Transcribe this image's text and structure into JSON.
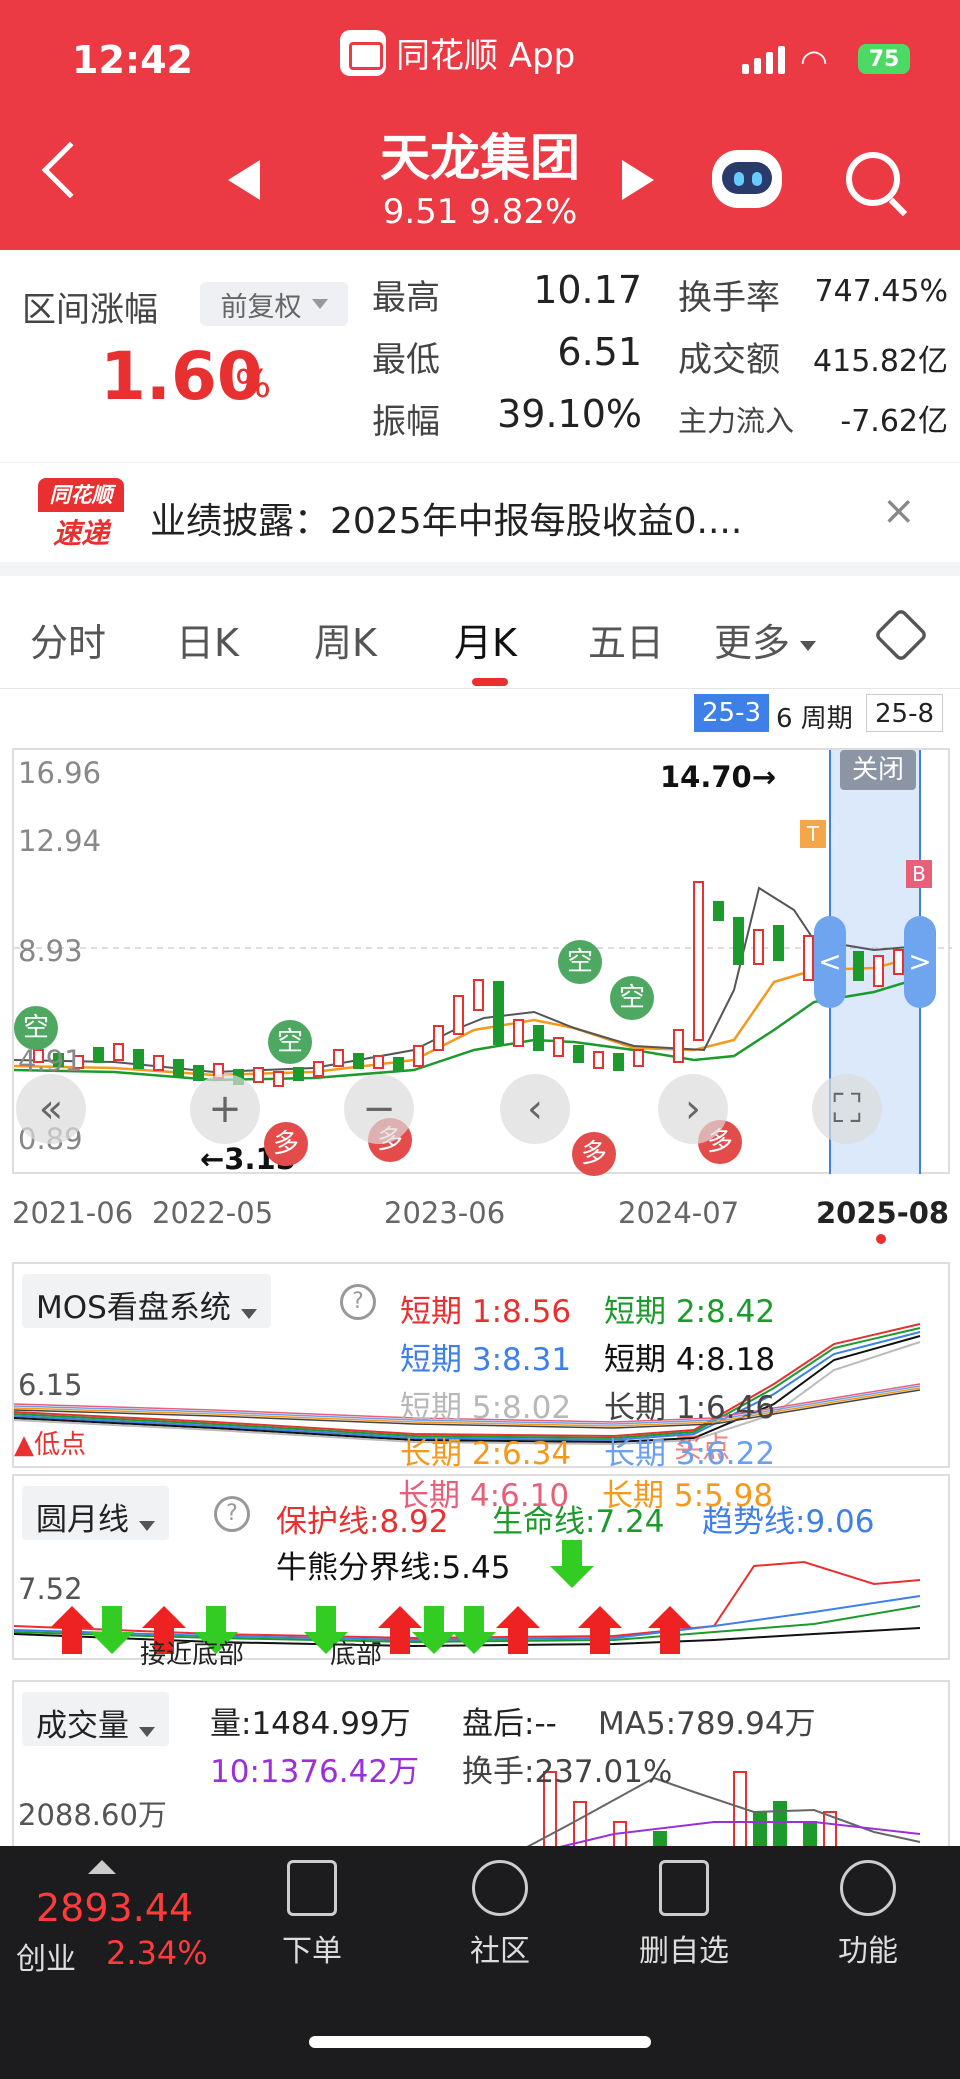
{
  "status": {
    "time": "12:42",
    "battery": "75"
  },
  "app": {
    "title": "同花顺 App"
  },
  "stock": {
    "name": "天龙集团",
    "price_line": "9.51  9.82%"
  },
  "stats": {
    "range_label": "区间涨幅",
    "adjust_label": "前复权",
    "range_value": "1.60",
    "range_unit": "%",
    "high_label": "最高",
    "high_value": "10.17",
    "low_label": "最低",
    "low_value": "6.51",
    "amp_label": "振幅",
    "amp_value": "39.10%",
    "turnover_label": "换手率",
    "turnover_value": "747.45%",
    "volume_label": "成交额",
    "volume_value": "415.82亿",
    "flow_label": "主力流入",
    "flow_value": "-7.62亿"
  },
  "banner": {
    "badge_top": "同花顺",
    "badge_bottom": "速递",
    "text": "业绩披露：2025年中报每股收益0....",
    "close": "×"
  },
  "tabs": [
    "分时",
    "日K",
    "周K",
    "月K",
    "五日",
    "更多"
  ],
  "range_bar": {
    "start": "25-3",
    "period": "6 周期",
    "end": "25-8"
  },
  "kline": {
    "y_ticks": [
      "16.96",
      "12.94",
      "8.93",
      "4.91",
      "0.89"
    ],
    "x_ticks": [
      "2021-06",
      "2022-05",
      "2023-06",
      "2024-07",
      "2025-08"
    ],
    "max_label": "14.70→",
    "min_label": "←3.15",
    "close_button": "关闭",
    "signals": {
      "kong": "空",
      "duo": "多",
      "t": "T",
      "b": "B"
    }
  },
  "mos": {
    "name": "MOS看盘系统",
    "y_tick": "6.15",
    "low_point": "▲低点",
    "legend": [
      {
        "text": "短期 1:8.56",
        "color": "#e93030"
      },
      {
        "text": "短期 2:8.42",
        "color": "#1c9a2c"
      },
      {
        "text": "短期 3:8.31",
        "color": "#3f7fe8"
      },
      {
        "text": "短期 4:8.18",
        "color": "#111111"
      },
      {
        "text": "短期 5:8.02",
        "color": "#b8b8b8"
      },
      {
        "text": "长期 1:6.46",
        "color": "#444444"
      },
      {
        "text": "长期 2:6.34",
        "color": "#f39a1e"
      },
      {
        "text": "长期 3:6.22",
        "color": "#6aa0f0"
      },
      {
        "text": "长期 4:6.10",
        "color": "#e85f7a"
      },
      {
        "text": "长期 5:5.98",
        "color": "#f39a1e"
      }
    ],
    "overlay": "买点"
  },
  "yuanyue": {
    "name": "圆月线",
    "y_tick": "7.52",
    "legend": [
      {
        "text": "保护线:8.92",
        "color": "#e93030"
      },
      {
        "text": "生命线:7.24",
        "color": "#1c9a2c"
      },
      {
        "text": "趋势线:9.06",
        "color": "#3f7fe8"
      },
      {
        "text": "牛熊分界线:5.45",
        "color": "#111111"
      }
    ],
    "notes": [
      "接近底部",
      "底部"
    ]
  },
  "volume": {
    "name": "成交量",
    "vol": "量:1484.99万",
    "after": "盘后:--",
    "ma5": "MA5:789.94万",
    "ma10": "10:1376.42万",
    "turnover": "换手:237.01%",
    "y_tick": "2088.60万"
  },
  "bottom": {
    "index_value": "2893.44",
    "index_name": "创业",
    "index_change": "2.34%",
    "items": [
      "下单",
      "社区",
      "删自选",
      "功能"
    ]
  },
  "colors": {
    "red": "#ec3a44",
    "green": "#1c9a2c",
    "blue": "#3f7fe8"
  }
}
